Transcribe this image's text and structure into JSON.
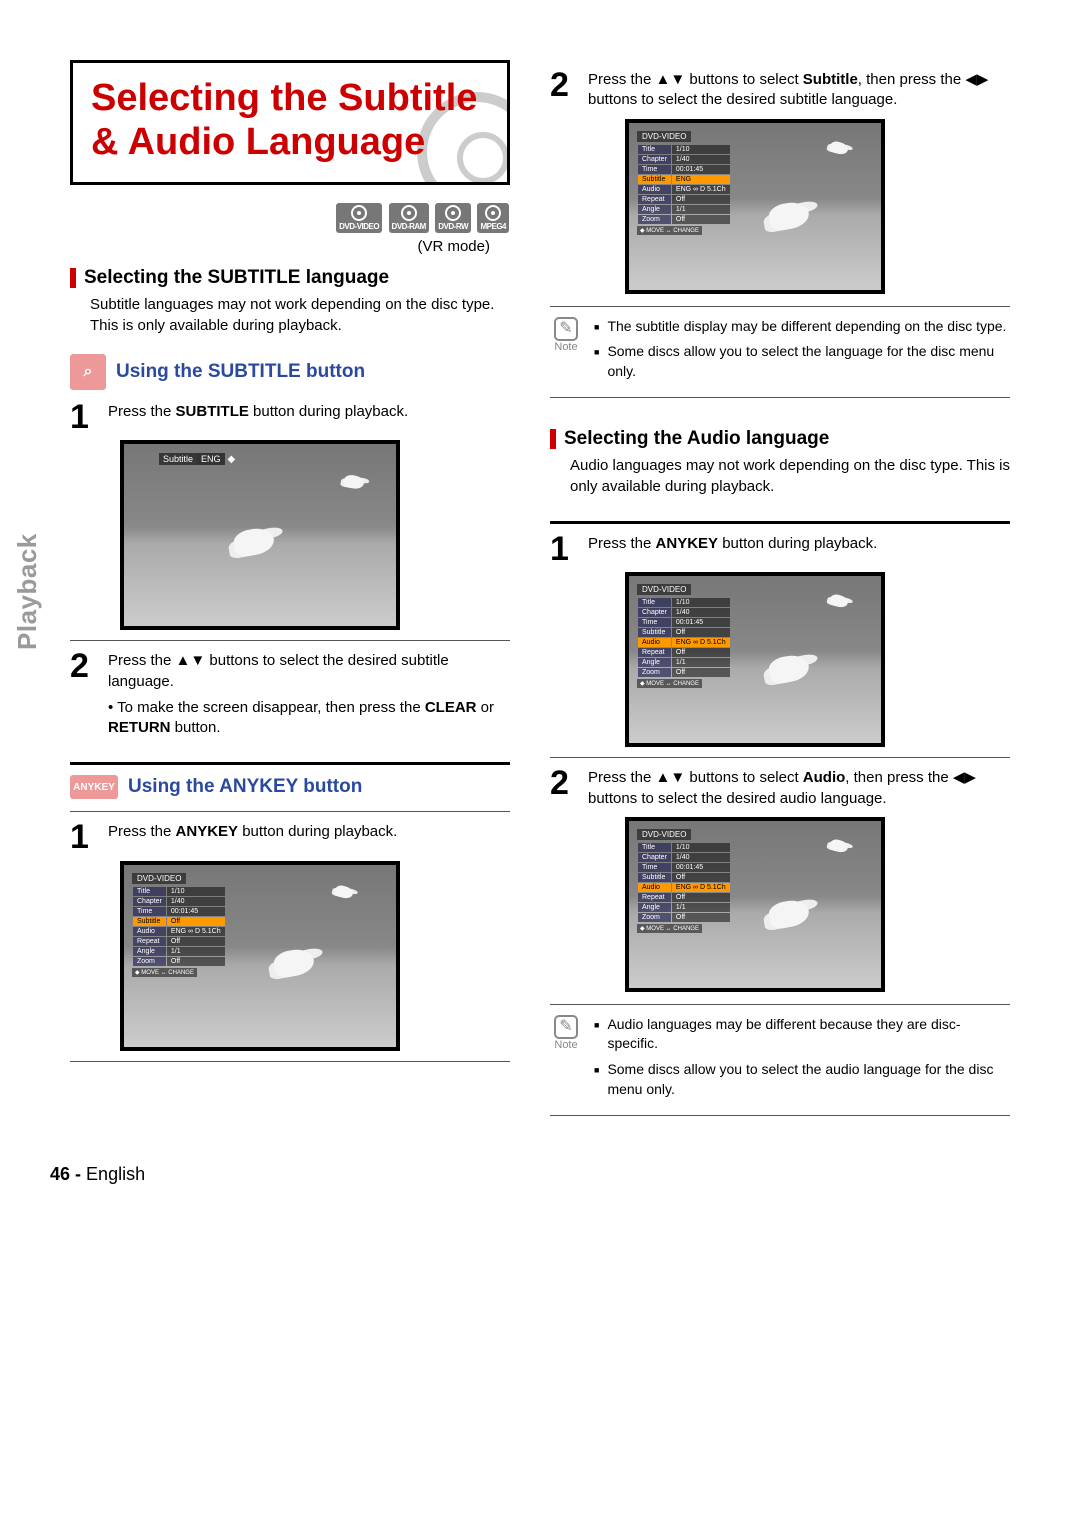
{
  "sidebar_tab": "Playback",
  "title": "Selecting the Subtitle & Audio Language",
  "disc_icons": [
    "DVD-VIDEO",
    "DVD-RAM",
    "DVD-RW",
    "MPEG4"
  ],
  "vr_mode": "(VR mode)",
  "left": {
    "sec1_title": "Selecting the SUBTITLE language",
    "sec1_intro": "Subtitle languages may not work depending on the disc type. This is only available during playback.",
    "sub1_title": "Using the SUBTITLE button",
    "step1a_pre": "Press the ",
    "step1a_bold": "SUBTITLE",
    "step1a_post": " button during playback.",
    "screenshot_sub": {
      "label": "Subtitle",
      "value": "ENG"
    },
    "step2a_pre": "Press the ▲▼ buttons to select the desired subtitle language.",
    "step2a_bullet_pre": "• To make the screen disappear, then press the ",
    "step2a_bullet_bold": "CLEAR",
    "step2a_bullet_mid": " or ",
    "step2a_bullet_bold2": "RETURN",
    "step2a_bullet_post": " button.",
    "sub2_title": "Using the ANYKEY button",
    "anykey_label": "ANYKEY",
    "step1b_pre": "Press the ",
    "step1b_bold": "ANYKEY",
    "step1b_post": " button during playback.",
    "osd": {
      "header": "DVD-VIDEO",
      "rows": [
        {
          "lbl": "Title",
          "val": "1/10"
        },
        {
          "lbl": "Chapter",
          "val": "1/40"
        },
        {
          "lbl": "Time",
          "val": "00:01:45"
        },
        {
          "lbl": "Subtitle",
          "val": "Off",
          "hl": true
        },
        {
          "lbl": "Audio",
          "val": "ENG ∞ D 5.1Ch"
        },
        {
          "lbl": "Repeat",
          "val": "Off"
        },
        {
          "lbl": "Angle",
          "val": "1/1"
        },
        {
          "lbl": "Zoom",
          "val": "Off"
        }
      ],
      "footer": "◆ MOVE   ↔ CHANGE"
    }
  },
  "right": {
    "step2_pre": "Press the ▲▼ buttons to select ",
    "step2_bold": "Subtitle",
    "step2_post": ", then press the ◀▶ buttons to select the desired subtitle language.",
    "osd_sub": {
      "header": "DVD-VIDEO",
      "rows": [
        {
          "lbl": "Title",
          "val": "1/10"
        },
        {
          "lbl": "Chapter",
          "val": "1/40"
        },
        {
          "lbl": "Time",
          "val": "00:01:45"
        },
        {
          "lbl": "Subtitle",
          "val": "ENG",
          "hl": true
        },
        {
          "lbl": "Audio",
          "val": "ENG ∞ D 5.1Ch"
        },
        {
          "lbl": "Repeat",
          "val": "Off"
        },
        {
          "lbl": "Angle",
          "val": "1/1"
        },
        {
          "lbl": "Zoom",
          "val": "Off"
        }
      ],
      "footer": "◆ MOVE   ↔ CHANGE"
    },
    "note1": {
      "label": "Note",
      "items": [
        "The subtitle display may be different depending on the disc type.",
        "Some discs allow you to select the language for the disc menu only."
      ]
    },
    "sec2_title": "Selecting the Audio language",
    "sec2_intro": "Audio languages may not work depending on the disc type. This is only available during playback.",
    "step1c_pre": "Press the ",
    "step1c_bold": "ANYKEY",
    "step1c_post": " button during playback.",
    "osd_audio1": {
      "header": "DVD-VIDEO",
      "rows": [
        {
          "lbl": "Title",
          "val": "1/10"
        },
        {
          "lbl": "Chapter",
          "val": "1/40"
        },
        {
          "lbl": "Time",
          "val": "00:01:45"
        },
        {
          "lbl": "Subtitle",
          "val": "Off"
        },
        {
          "lbl": "Audio",
          "val": "ENG ∞ D 5.1Ch",
          "hl": true
        },
        {
          "lbl": "Repeat",
          "val": "Off"
        },
        {
          "lbl": "Angle",
          "val": "1/1"
        },
        {
          "lbl": "Zoom",
          "val": "Off"
        }
      ],
      "footer": "◆ MOVE   ↔ CHANGE"
    },
    "step2c_pre": "Press the ▲▼ buttons to select ",
    "step2c_bold": "Audio",
    "step2c_post": ", then press the ◀▶ buttons to select the desired audio language.",
    "osd_audio2": {
      "header": "DVD-VIDEO",
      "rows": [
        {
          "lbl": "Title",
          "val": "1/10"
        },
        {
          "lbl": "Chapter",
          "val": "1/40"
        },
        {
          "lbl": "Time",
          "val": "00:01:45"
        },
        {
          "lbl": "Subtitle",
          "val": "Off"
        },
        {
          "lbl": "Audio",
          "val": "ENG ∞ D 5.1Ch",
          "hl": true
        },
        {
          "lbl": "Repeat",
          "val": "Off"
        },
        {
          "lbl": "Angle",
          "val": "1/1"
        },
        {
          "lbl": "Zoom",
          "val": "Off"
        }
      ],
      "footer": "◆ MOVE   ↔ CHANGE"
    },
    "note2": {
      "label": "Note",
      "items": [
        "Audio languages may be different because they are disc-specific.",
        "Some discs allow you to select the audio language for the disc menu only."
      ]
    }
  },
  "footer": {
    "page": "46 -",
    "lang": "English"
  }
}
